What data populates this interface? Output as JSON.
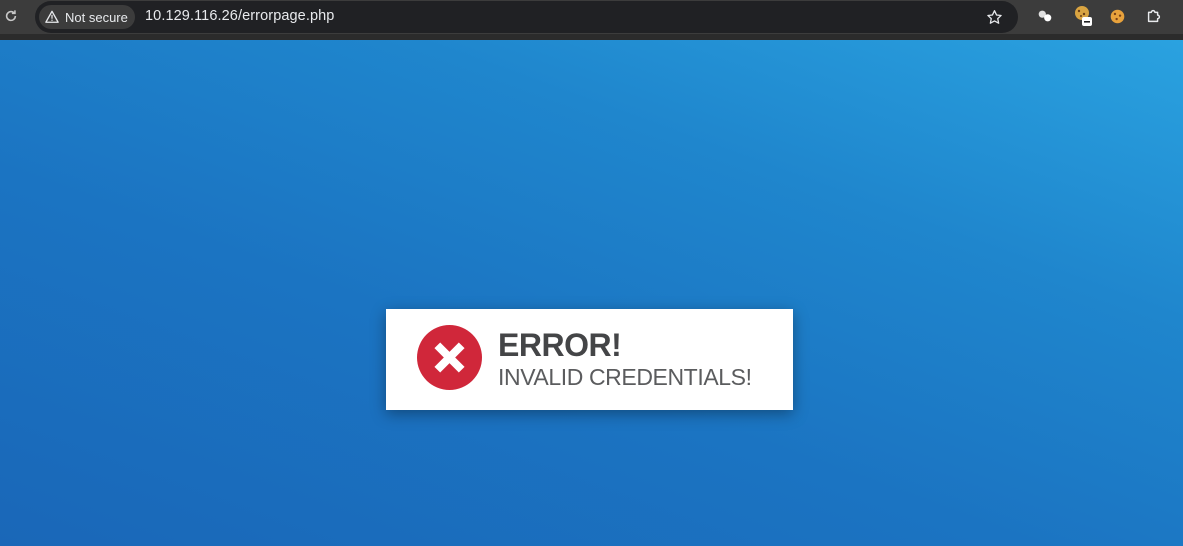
{
  "browser": {
    "security_label": "Not secure",
    "url": "10.129.116.26/errorpage.php",
    "icons": {
      "reload": "reload-icon",
      "warning": "warning-triangle-icon",
      "bookmark": "star-icon",
      "extensions": [
        "extension-circles-icon",
        "cookie-blocked-icon",
        "cookie-icon",
        "puzzle-icon"
      ]
    }
  },
  "alert": {
    "title": "ERROR!",
    "message": "INVALID CREDENTIALS!",
    "icon": "error-x-circle-icon",
    "colors": {
      "icon": "#d0273a",
      "title": "#444547",
      "background": "#ffffff"
    }
  },
  "page": {
    "background_colors": [
      "#2aa2e0",
      "#1b74c2",
      "#1a67b8"
    ]
  }
}
